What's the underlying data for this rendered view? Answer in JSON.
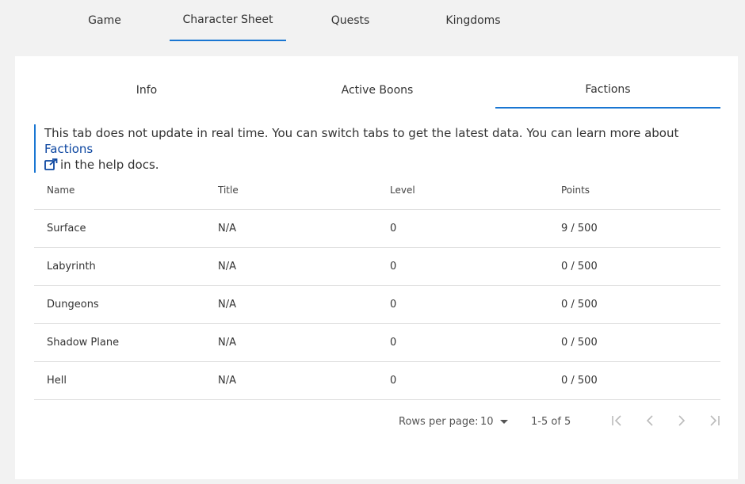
{
  "top_tabs": [
    {
      "label": "Game"
    },
    {
      "label": "Character Sheet"
    },
    {
      "label": "Quests"
    },
    {
      "label": "Kingdoms"
    }
  ],
  "inner_tabs": [
    {
      "label": "Info"
    },
    {
      "label": "Active Boons"
    },
    {
      "label": "Factions"
    }
  ],
  "notice": {
    "text": "This tab does not update in real time. You can switch tabs to get the latest data. You can learn more about ",
    "link": "Factions",
    "suffix": "in the help docs."
  },
  "table": {
    "headers": [
      "Name",
      "Title",
      "Level",
      "Points"
    ],
    "rows": [
      [
        "Surface",
        "N/A",
        "0",
        "9 / 500"
      ],
      [
        "Labyrinth",
        "N/A",
        "0",
        "0 / 500"
      ],
      [
        "Dungeons",
        "N/A",
        "0",
        "0 / 500"
      ],
      [
        "Shadow Plane",
        "N/A",
        "0",
        "0 / 500"
      ],
      [
        "Hell",
        "N/A",
        "0",
        "0 / 500"
      ]
    ]
  },
  "pagination": {
    "rows_label": "Rows per page:",
    "rows_value": "10",
    "range": "1-5 of 5"
  },
  "colors": {
    "accent": "#1976d2",
    "link": "#0d47a1",
    "background": "#f2f2f2",
    "card": "#ffffff"
  }
}
